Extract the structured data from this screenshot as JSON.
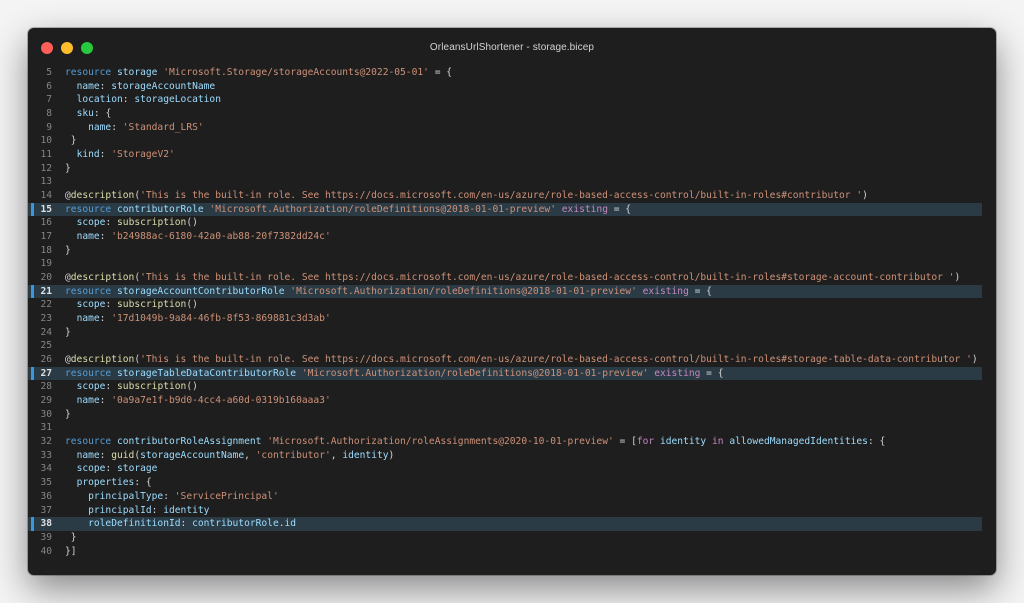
{
  "window": {
    "title": "OrleansUrlShortener - storage.bicep",
    "traffic_lights": [
      {
        "name": "close",
        "color": "#ff5f56"
      },
      {
        "name": "minimize",
        "color": "#ffbd2e"
      },
      {
        "name": "maximize",
        "color": "#27c93f"
      }
    ]
  },
  "theme": {
    "background": "#1e1e1e",
    "highlight_line": "#2a3b46",
    "gutter_marker": "#3a96dd"
  },
  "editor": {
    "highlighted_lines": [
      15,
      21,
      27,
      38
    ],
    "lines": [
      {
        "n": "5",
        "hl": false,
        "tokens": [
          [
            "kw",
            "resource"
          ],
          [
            "pn",
            " "
          ],
          [
            "id",
            "storage"
          ],
          [
            "pn",
            " "
          ],
          [
            "str",
            "'Microsoft.Storage/storageAccounts@2022-05-01'"
          ],
          [
            "pn",
            " = {"
          ]
        ]
      },
      {
        "n": "6",
        "hl": false,
        "tokens": [
          [
            "pn",
            "  "
          ],
          [
            "id",
            "name"
          ],
          [
            "pn",
            ": "
          ],
          [
            "id",
            "storageAccountName"
          ]
        ]
      },
      {
        "n": "7",
        "hl": false,
        "tokens": [
          [
            "pn",
            "  "
          ],
          [
            "id",
            "location"
          ],
          [
            "pn",
            ": "
          ],
          [
            "id",
            "storageLocation"
          ]
        ]
      },
      {
        "n": "8",
        "hl": false,
        "tokens": [
          [
            "pn",
            "  "
          ],
          [
            "id",
            "sku"
          ],
          [
            "pn",
            ": {"
          ]
        ]
      },
      {
        "n": "9",
        "hl": false,
        "tokens": [
          [
            "pn",
            "    "
          ],
          [
            "id",
            "name"
          ],
          [
            "pn",
            ": "
          ],
          [
            "str",
            "'Standard_LRS'"
          ]
        ]
      },
      {
        "n": "10",
        "hl": false,
        "tokens": [
          [
            "pn",
            " }"
          ]
        ]
      },
      {
        "n": "11",
        "hl": false,
        "tokens": [
          [
            "pn",
            "  "
          ],
          [
            "id",
            "kind"
          ],
          [
            "pn",
            ": "
          ],
          [
            "str",
            "'StorageV2'"
          ]
        ]
      },
      {
        "n": "12",
        "hl": false,
        "tokens": [
          [
            "pn",
            "}"
          ]
        ]
      },
      {
        "n": "13",
        "hl": false,
        "tokens": []
      },
      {
        "n": "14",
        "hl": false,
        "tokens": [
          [
            "pn",
            "@"
          ],
          [
            "fn",
            "description"
          ],
          [
            "pn",
            "("
          ],
          [
            "str",
            "'This is the built-in role. See https://docs.microsoft.com/en-us/azure/role-based-access-control/built-in-roles#contributor '"
          ],
          [
            "pn",
            ")"
          ]
        ]
      },
      {
        "n": "15",
        "hl": true,
        "tokens": [
          [
            "kw",
            "resource"
          ],
          [
            "pn",
            " "
          ],
          [
            "id",
            "contributorRole"
          ],
          [
            "pn",
            " "
          ],
          [
            "str",
            "'Microsoft.Authorization/roleDefinitions@2018-01-01-preview'"
          ],
          [
            "pn",
            " "
          ],
          [
            "ctl",
            "existing"
          ],
          [
            "pn",
            " = {"
          ]
        ]
      },
      {
        "n": "16",
        "hl": false,
        "tokens": [
          [
            "pn",
            "  "
          ],
          [
            "id",
            "scope"
          ],
          [
            "pn",
            ": "
          ],
          [
            "fn",
            "subscription"
          ],
          [
            "pn",
            "()"
          ]
        ]
      },
      {
        "n": "17",
        "hl": false,
        "tokens": [
          [
            "pn",
            "  "
          ],
          [
            "id",
            "name"
          ],
          [
            "pn",
            ": "
          ],
          [
            "str",
            "'b24988ac-6180-42a0-ab88-20f7382dd24c'"
          ]
        ]
      },
      {
        "n": "18",
        "hl": false,
        "tokens": [
          [
            "pn",
            "}"
          ]
        ]
      },
      {
        "n": "19",
        "hl": false,
        "tokens": []
      },
      {
        "n": "20",
        "hl": false,
        "tokens": [
          [
            "pn",
            "@"
          ],
          [
            "fn",
            "description"
          ],
          [
            "pn",
            "("
          ],
          [
            "str",
            "'This is the built-in role. See https://docs.microsoft.com/en-us/azure/role-based-access-control/built-in-roles#storage-account-contributor '"
          ],
          [
            "pn",
            ")"
          ]
        ]
      },
      {
        "n": "21",
        "hl": true,
        "tokens": [
          [
            "kw",
            "resource"
          ],
          [
            "pn",
            " "
          ],
          [
            "id",
            "storageAccountContributorRole"
          ],
          [
            "pn",
            " "
          ],
          [
            "str",
            "'Microsoft.Authorization/roleDefinitions@2018-01-01-preview'"
          ],
          [
            "pn",
            " "
          ],
          [
            "ctl",
            "existing"
          ],
          [
            "pn",
            " = {"
          ]
        ]
      },
      {
        "n": "22",
        "hl": false,
        "tokens": [
          [
            "pn",
            "  "
          ],
          [
            "id",
            "scope"
          ],
          [
            "pn",
            ": "
          ],
          [
            "fn",
            "subscription"
          ],
          [
            "pn",
            "()"
          ]
        ]
      },
      {
        "n": "23",
        "hl": false,
        "tokens": [
          [
            "pn",
            "  "
          ],
          [
            "id",
            "name"
          ],
          [
            "pn",
            ": "
          ],
          [
            "str",
            "'17d1049b-9a84-46fb-8f53-869881c3d3ab'"
          ]
        ]
      },
      {
        "n": "24",
        "hl": false,
        "tokens": [
          [
            "pn",
            "}"
          ]
        ]
      },
      {
        "n": "25",
        "hl": false,
        "tokens": []
      },
      {
        "n": "26",
        "hl": false,
        "tokens": [
          [
            "pn",
            "@"
          ],
          [
            "fn",
            "description"
          ],
          [
            "pn",
            "("
          ],
          [
            "str",
            "'This is the built-in role. See https://docs.microsoft.com/en-us/azure/role-based-access-control/built-in-roles#storage-table-data-contributor '"
          ],
          [
            "pn",
            ")"
          ]
        ]
      },
      {
        "n": "27",
        "hl": true,
        "tokens": [
          [
            "kw",
            "resource"
          ],
          [
            "pn",
            " "
          ],
          [
            "id",
            "storageTableDataContributorRole"
          ],
          [
            "pn",
            " "
          ],
          [
            "str",
            "'Microsoft.Authorization/roleDefinitions@2018-01-01-preview'"
          ],
          [
            "pn",
            " "
          ],
          [
            "ctl",
            "existing"
          ],
          [
            "pn",
            " = {"
          ]
        ]
      },
      {
        "n": "28",
        "hl": false,
        "tokens": [
          [
            "pn",
            "  "
          ],
          [
            "id",
            "scope"
          ],
          [
            "pn",
            ": "
          ],
          [
            "fn",
            "subscription"
          ],
          [
            "pn",
            "()"
          ]
        ]
      },
      {
        "n": "29",
        "hl": false,
        "tokens": [
          [
            "pn",
            "  "
          ],
          [
            "id",
            "name"
          ],
          [
            "pn",
            ": "
          ],
          [
            "str",
            "'0a9a7e1f-b9d0-4cc4-a60d-0319b160aaa3'"
          ]
        ]
      },
      {
        "n": "30",
        "hl": false,
        "tokens": [
          [
            "pn",
            "}"
          ]
        ]
      },
      {
        "n": "31",
        "hl": false,
        "tokens": []
      },
      {
        "n": "32",
        "hl": false,
        "tokens": [
          [
            "kw",
            "resource"
          ],
          [
            "pn",
            " "
          ],
          [
            "id",
            "contributorRoleAssignment"
          ],
          [
            "pn",
            " "
          ],
          [
            "str",
            "'Microsoft.Authorization/roleAssignments@2020-10-01-preview'"
          ],
          [
            "pn",
            " = ["
          ],
          [
            "ctl",
            "for"
          ],
          [
            "pn",
            " "
          ],
          [
            "id",
            "identity"
          ],
          [
            "pn",
            " "
          ],
          [
            "ctl",
            "in"
          ],
          [
            "pn",
            " "
          ],
          [
            "id",
            "allowedManagedIdentities"
          ],
          [
            "pn",
            ": {"
          ]
        ]
      },
      {
        "n": "33",
        "hl": false,
        "tokens": [
          [
            "pn",
            "  "
          ],
          [
            "id",
            "name"
          ],
          [
            "pn",
            ": "
          ],
          [
            "fn",
            "guid"
          ],
          [
            "pn",
            "("
          ],
          [
            "id",
            "storageAccountName"
          ],
          [
            "pn",
            ", "
          ],
          [
            "str",
            "'contributor'"
          ],
          [
            "pn",
            ", "
          ],
          [
            "id",
            "identity"
          ],
          [
            "pn",
            ")"
          ]
        ]
      },
      {
        "n": "34",
        "hl": false,
        "tokens": [
          [
            "pn",
            "  "
          ],
          [
            "id",
            "scope"
          ],
          [
            "pn",
            ": "
          ],
          [
            "id",
            "storage"
          ]
        ]
      },
      {
        "n": "35",
        "hl": false,
        "tokens": [
          [
            "pn",
            "  "
          ],
          [
            "id",
            "properties"
          ],
          [
            "pn",
            ": {"
          ]
        ]
      },
      {
        "n": "36",
        "hl": false,
        "tokens": [
          [
            "pn",
            "    "
          ],
          [
            "id",
            "principalType"
          ],
          [
            "pn",
            ": "
          ],
          [
            "str",
            "'ServicePrincipal'"
          ]
        ]
      },
      {
        "n": "37",
        "hl": false,
        "tokens": [
          [
            "pn",
            "    "
          ],
          [
            "id",
            "principalId"
          ],
          [
            "pn",
            ": "
          ],
          [
            "id",
            "identity"
          ]
        ]
      },
      {
        "n": "38",
        "hl": true,
        "tokens": [
          [
            "pn",
            "    "
          ],
          [
            "id",
            "roleDefinitionId"
          ],
          [
            "pn",
            ": "
          ],
          [
            "id",
            "contributorRole"
          ],
          [
            "pn",
            "."
          ],
          [
            "id",
            "id"
          ]
        ]
      },
      {
        "n": "39",
        "hl": false,
        "tokens": [
          [
            "pn",
            " }"
          ]
        ]
      },
      {
        "n": "40",
        "hl": false,
        "tokens": [
          [
            "pn",
            "}]"
          ]
        ]
      }
    ]
  }
}
